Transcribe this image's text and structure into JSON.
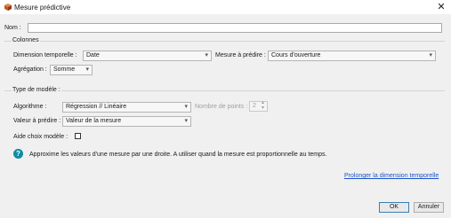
{
  "window": {
    "title": "Mesure prédictive",
    "close_symbol": "✕"
  },
  "name_field": {
    "label": "Nom :",
    "value": ""
  },
  "columns_group": {
    "title": "Colonnes",
    "time_dimension": {
      "label": "Dimension temporelle :",
      "value": "Date"
    },
    "measure_to_predict": {
      "label": "Mesure à prédire :",
      "value": "Cours d'ouverture"
    },
    "aggregation": {
      "label": "Agrégation :",
      "value": "Somme"
    }
  },
  "model_group": {
    "title": "Type de modèle :",
    "algorithm": {
      "label": "Algorithme :",
      "value": "Régression // Linéaire"
    },
    "points_count": {
      "label": "Nombre de points :",
      "value": "2"
    },
    "value_to_predict": {
      "label": "Valeur à prédire :",
      "value": "Valeur de la mesure"
    },
    "help_model_choice": {
      "label": "Aide choix modèle :",
      "checked": false
    }
  },
  "info": {
    "icon": "help-circle-icon",
    "text": "Approxime les valeurs d'une mesure par une droite. A utiliser quand la mesure est proportionnelle au temps."
  },
  "extend_link": "Prolonger la dimension temporelle",
  "buttons": {
    "ok": "OK",
    "cancel": "Annuler"
  },
  "icons": {
    "dropdown": "▾",
    "spinner_up": "▴",
    "spinner_down": "▾"
  },
  "colors": {
    "link": "#1c55c9",
    "help_icon": "#128aa2",
    "dialog_bg": "#f0f0f0"
  }
}
